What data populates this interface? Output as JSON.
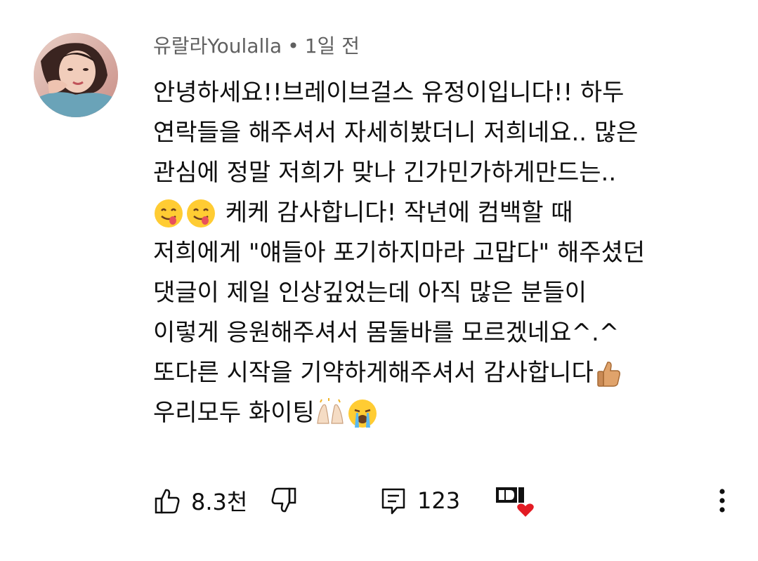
{
  "comment": {
    "author": "유랄라Youlalla",
    "separator": "•",
    "time": "1일 전",
    "lines": [
      "안녕하세요!!브레이브걸스 유정이입니다!! 하두",
      "연락들을 해주셔서 자세히봤더니 저희네요.. 많은",
      "관심에 정말 저희가 맞나 긴가민가하게만드는..",
      " 케케 감사합니다! 작년에 컴백할 때",
      "저희에게 \"얘들아 포기하지마라 고맙다\" 해주셨던",
      "댓글이 제일 인상깊었는데 아직 많은 분들이",
      "이렇게 응원해주셔서 몸둘바를 모르겠네요^.^",
      "또다른 시작을 기약하게해주셔서 감사합니다",
      "우리모두 화이팅"
    ],
    "emojis": {
      "line4_lead": [
        "yum-face-emoji",
        "yum-face-emoji"
      ],
      "line8_tail": [
        "thumbs-up-emoji"
      ],
      "line9_tail": [
        "raised-hands-emoji",
        "loudly-crying-face-emoji"
      ]
    }
  },
  "actions": {
    "like_count": "8.3천",
    "reply_count": "123",
    "heart_badge_icon": "creator-heart-icon",
    "heart_color": "#e31b23"
  }
}
